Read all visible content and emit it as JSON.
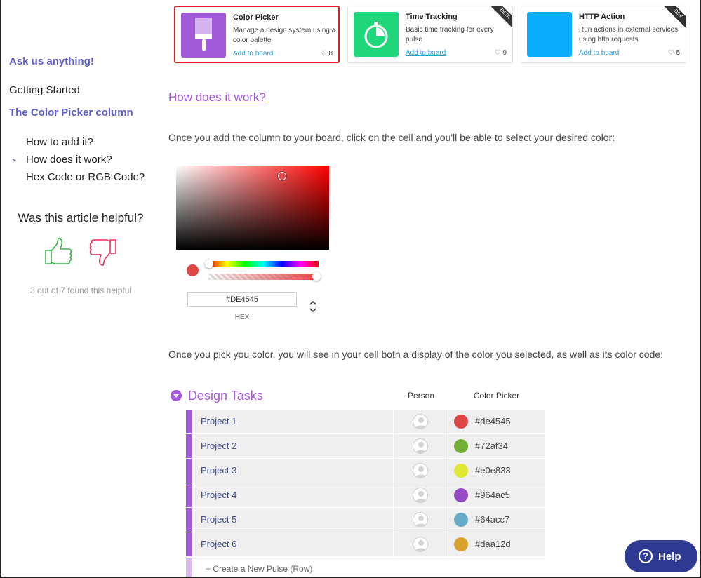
{
  "sidebar": {
    "ask_label": "Ask us anything!",
    "getting_started": "Getting Started",
    "section_title": "The Color Picker column",
    "toc": [
      {
        "label": "How to add it?",
        "active": false
      },
      {
        "label": "How does it work?",
        "active": true
      },
      {
        "label": "Hex Code or RGB Code?",
        "active": false
      }
    ],
    "helpful_title": "Was this article helpful?",
    "helpful_count": "3 out of 7 found this helpful",
    "icons": {
      "up": "thumbs-up-icon",
      "down": "thumbs-down-icon"
    }
  },
  "apps": [
    {
      "name": "Color Picker",
      "description": "Manage a design system using a color palette",
      "add_label": "Add to board",
      "likes": "8",
      "color": "#a35ad8",
      "ribbon": ""
    },
    {
      "name": "Time Tracking",
      "description": "Basic time tracking for every pulse",
      "add_label": "Add to board",
      "likes": "9",
      "color": "#20d67a",
      "ribbon": "BETA"
    },
    {
      "name": "HTTP Action",
      "description": "Run actions in external services using http requests",
      "add_label": "Add to board",
      "likes": "5",
      "color": "#0aaefd",
      "ribbon": "DEV"
    }
  ],
  "main": {
    "heading": "How does it work?",
    "intro": "Once you add the column to your board, click on the cell and you'll be able to select your desired color:",
    "after": "Once you pick you color, you will see in your cell both a display of the color you selected, as well as its color code:"
  },
  "picker": {
    "hex_value": "#DE4545",
    "hex_label": "HEX",
    "selected_color": "#DE4545"
  },
  "board": {
    "title": "Design Tasks",
    "col_person": "Person",
    "col_picker": "Color Picker",
    "rows": [
      {
        "name": "Project 1",
        "code": "#de4545",
        "color": "#de4545"
      },
      {
        "name": "Project 2",
        "code": "#72af34",
        "color": "#72af34"
      },
      {
        "name": "Project 3",
        "code": "#e0e833",
        "color": "#e0e833"
      },
      {
        "name": "Project 4",
        "code": "#964ac5",
        "color": "#964ac5"
      },
      {
        "name": "Project 5",
        "code": "#64acc7",
        "color": "#64acc7"
      },
      {
        "name": "Project 6",
        "code": "#daa12d",
        "color": "#daa12d"
      }
    ],
    "new_row": "+ Create a New Pulse (Row)"
  },
  "help": {
    "label": "Help"
  }
}
